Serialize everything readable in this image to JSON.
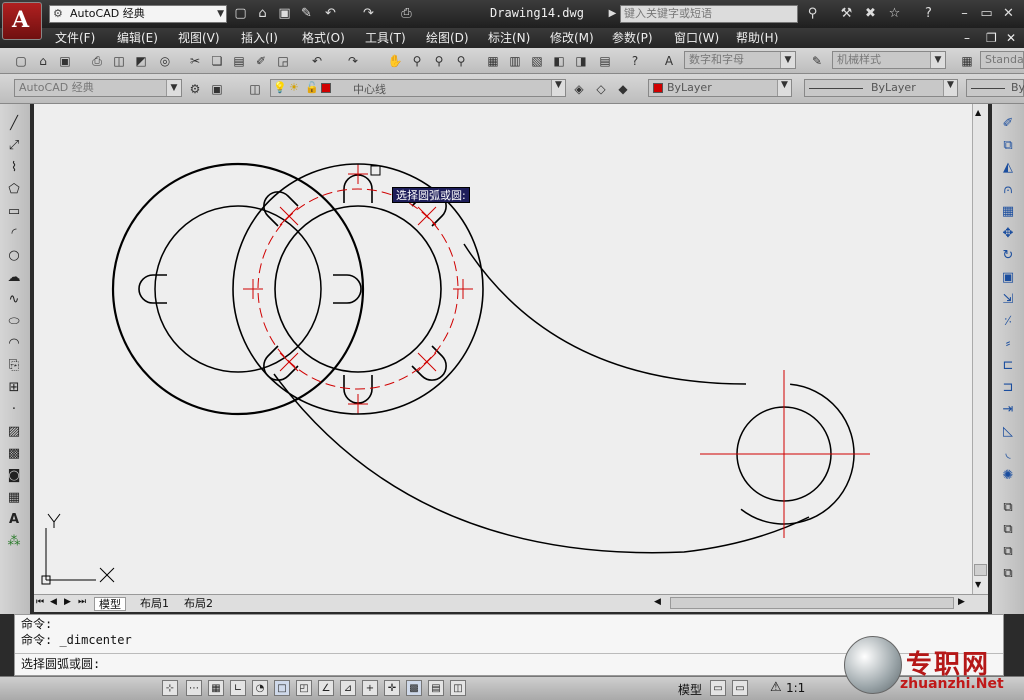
{
  "window": {
    "workspace": "AutoCAD 经典",
    "doc_title": "Drawing14.dwg",
    "search_placeholder": "键入关键字或短语"
  },
  "menu": [
    "文件(F)",
    "编辑(E)",
    "视图(V)",
    "插入(I)",
    "格式(O)",
    "工具(T)",
    "绘图(D)",
    "标注(N)",
    "修改(M)",
    "参数(P)",
    "窗口(W)",
    "帮助(H)"
  ],
  "toolbars": {
    "text_style": "数字和字母",
    "dim_style": "机械样式",
    "table_style": "Standa",
    "workspace2": "AutoCAD 经典",
    "layer": "中心线",
    "color": "ByLayer",
    "linetype": "ByLayer",
    "lineweight": "By"
  },
  "layout_tabs": [
    "模型",
    "布局1",
    "布局2"
  ],
  "tooltip": "选择圆弧或圆:",
  "command": {
    "history": [
      "命令:",
      "命令: _dimcenter"
    ],
    "prompt": "选择圆弧或圆:"
  },
  "status": {
    "model": "模型",
    "scale": "1:1"
  },
  "watermark": {
    "text": "专职网",
    "sub": "zhuanzhi.Net"
  },
  "colors": {
    "geometry": "#000000",
    "centerline": "#d00000",
    "canvas": "#eeeeee",
    "layer_color": "#d00000"
  }
}
